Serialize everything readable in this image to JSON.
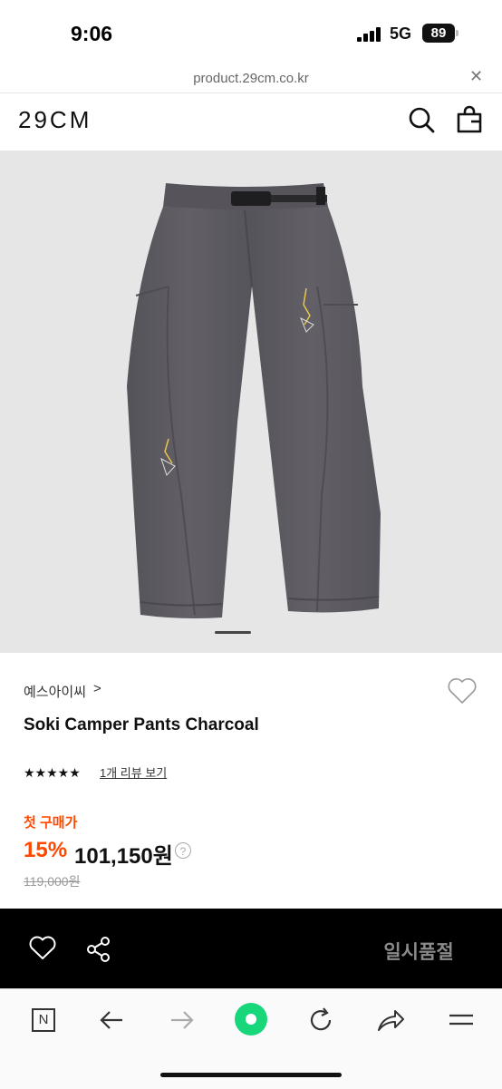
{
  "status_bar": {
    "time": "9:06",
    "network": "5G",
    "battery": "89"
  },
  "url_bar": {
    "url": "product.29cm.co.kr",
    "close": "✕"
  },
  "header": {
    "logo": "29CM",
    "icons": [
      "search-icon",
      "shopping-bag-icon"
    ]
  },
  "product": {
    "brand": "예스아이씨",
    "brand_chevron": ">",
    "title": "Soki Camper Pants Charcoal",
    "rating_stars": "★★★★★",
    "review_link": "1개 리뷰 보기",
    "first_purchase_label": "첫 구매가",
    "discount": "15%",
    "price": "101,150원",
    "help": "?",
    "original_price": "119,000원"
  },
  "action_bar": {
    "sold_out": "일시품절",
    "icons": [
      "heart-icon",
      "share-icon"
    ]
  },
  "browser_toolbar": {
    "icons": [
      "naver-n-icon",
      "back-arrow-icon",
      "forward-arrow-icon",
      "green-dot-icon",
      "refresh-icon",
      "share-arrow-icon",
      "menu-icon"
    ],
    "naver_label": "N"
  },
  "colors": {
    "accent": "#ff4800",
    "action_bar": "#000000",
    "product_bg": "#e6e6e6",
    "pants": "#5d5b61"
  }
}
